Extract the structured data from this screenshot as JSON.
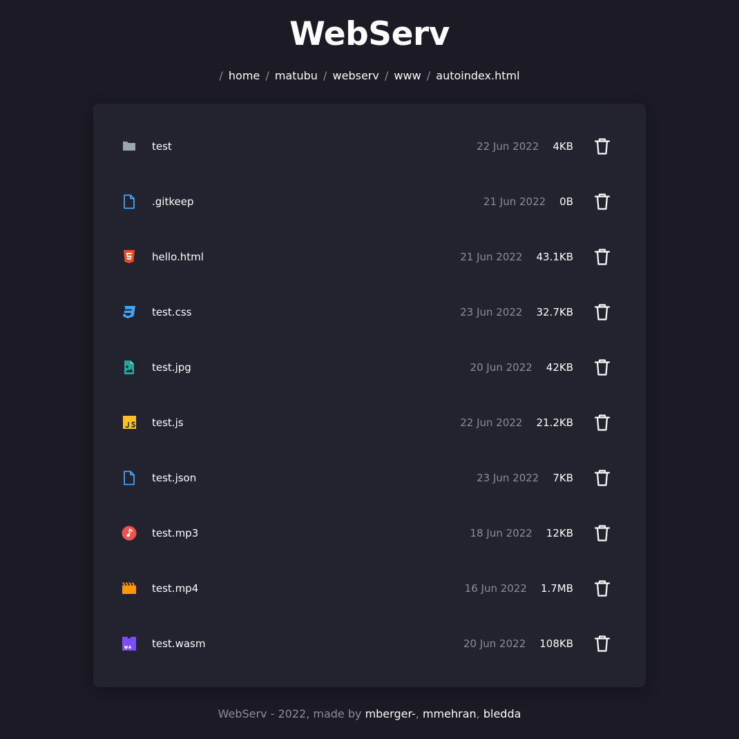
{
  "app": {
    "title": "WebServ"
  },
  "breadcrumb": {
    "separator": "/",
    "items": [
      "home",
      "matubu",
      "webserv",
      "www",
      "autoindex.html"
    ]
  },
  "files": [
    {
      "name": "test",
      "date": "22 Jun 2022",
      "size": "4KB",
      "icon": "folder-icon",
      "color": "#9aa7b0"
    },
    {
      "name": ".gitkeep",
      "date": "21 Jun 2022",
      "size": "0B",
      "icon": "file-icon",
      "color": "#42a5f5"
    },
    {
      "name": "hello.html",
      "date": "21 Jun 2022",
      "size": "43.1KB",
      "icon": "html5-icon",
      "color": "#e44d26"
    },
    {
      "name": "test.css",
      "date": "23 Jun 2022",
      "size": "32.7KB",
      "icon": "css3-icon",
      "color": "#42a5f5"
    },
    {
      "name": "test.jpg",
      "date": "20 Jun 2022",
      "size": "42KB",
      "icon": "image-icon",
      "color": "#26a69a"
    },
    {
      "name": "test.js",
      "date": "22 Jun 2022",
      "size": "21.2KB",
      "icon": "javascript-icon",
      "color": "#f7c325"
    },
    {
      "name": "test.json",
      "date": "23 Jun 2022",
      "size": "7KB",
      "icon": "file-icon",
      "color": "#42a5f5"
    },
    {
      "name": "test.mp3",
      "date": "18 Jun 2022",
      "size": "12KB",
      "icon": "music-icon",
      "color": "#ef5350"
    },
    {
      "name": "test.mp4",
      "date": "16 Jun 2022",
      "size": "1.7MB",
      "icon": "video-icon",
      "color": "#ff9800"
    },
    {
      "name": "test.wasm",
      "date": "20 Jun 2022",
      "size": "108KB",
      "icon": "wasm-icon",
      "color": "#7c4dff"
    }
  ],
  "footer": {
    "prefix": "WebServ - 2022, made by",
    "authors": [
      "mberger-",
      "mmehran",
      "bledda"
    ],
    "separator": ","
  },
  "colors": {
    "background": "#1b1a25",
    "panel": "#23222f",
    "muted": "#8e8c99",
    "text": "#ffffff"
  }
}
